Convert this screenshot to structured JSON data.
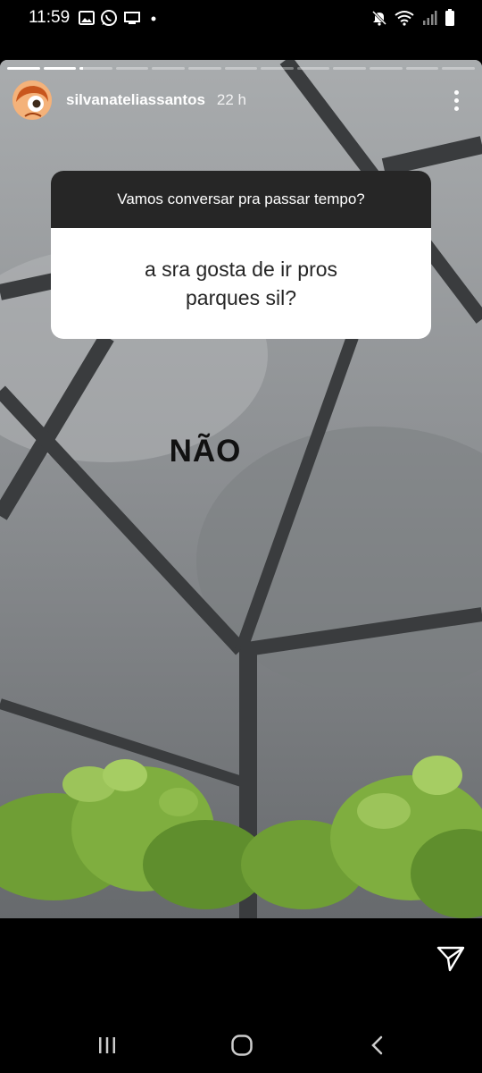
{
  "status_bar": {
    "time": "11:59",
    "left_icons": [
      "image-icon",
      "whatsapp-icon",
      "cast-icon",
      "dot-icon"
    ],
    "right_icons": [
      "mute-icon",
      "wifi-icon",
      "signal-icon",
      "battery-icon"
    ]
  },
  "story": {
    "progress": [
      {
        "fill": 1.0
      },
      {
        "fill": 1.0
      },
      {
        "fill": 0.1
      },
      {
        "fill": 0
      },
      {
        "fill": 0
      },
      {
        "fill": 0
      },
      {
        "fill": 0
      },
      {
        "fill": 0
      },
      {
        "fill": 0
      },
      {
        "fill": 0
      },
      {
        "fill": 0
      },
      {
        "fill": 0
      },
      {
        "fill": 0
      }
    ],
    "username": "silvanateliassantos",
    "time_ago": "22 h",
    "question_prompt": "Vamos conversar pra passar tempo?",
    "question_answer": "a sra gosta de ir pros parques sil?",
    "sticker_text": "NÃO"
  },
  "colors": {
    "question_header_bg": "#262626",
    "question_body_bg": "#ffffff",
    "sky": "#8e9194",
    "frame": "#3a3c3e",
    "leaves": "#7fae3f"
  }
}
